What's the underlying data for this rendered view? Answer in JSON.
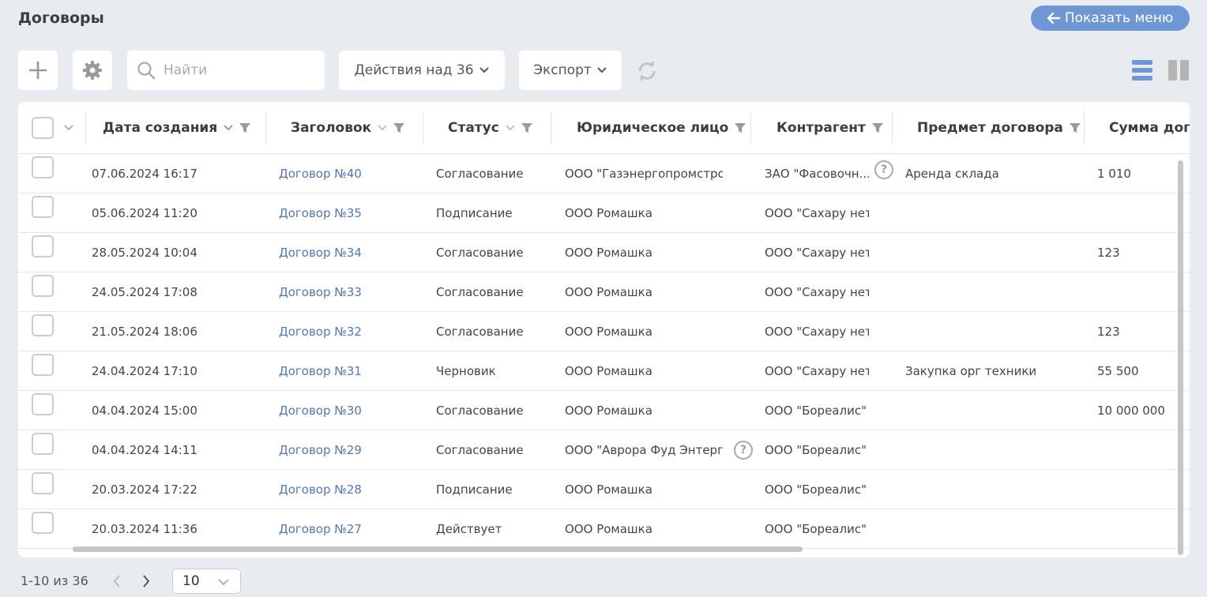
{
  "page": {
    "title": "Договоры",
    "show_menu": "Показать меню"
  },
  "toolbar": {
    "search_placeholder": "Найти",
    "actions_label": "Действия над 36",
    "export_label": "Экспорт"
  },
  "columns": [
    "Дата создания",
    "Заголовок",
    "Статус",
    "Юридическое лицо",
    "Контрагент",
    "Предмет договора",
    "Сумма дого"
  ],
  "rows": [
    {
      "date": "07.06.2024 16:17",
      "title": "Договор №40",
      "status": "Согласование",
      "entity": "ООО \"Газэнергопромстрой\"",
      "counterparty": "ЗАО \"Фасовочн...",
      "subject": "Аренда склада",
      "amount": "1 010"
    },
    {
      "date": "05.06.2024 11:20",
      "title": "Договор №35",
      "status": "Подписание",
      "entity": "ООО Ромашка",
      "counterparty": "ООО \"Сахару нет\"",
      "subject": "",
      "amount": ""
    },
    {
      "date": "28.05.2024 10:04",
      "title": "Договор №34",
      "status": "Согласование",
      "entity": "ООО Ромашка",
      "counterparty": "ООО \"Сахару нет\"",
      "subject": "",
      "amount": "123"
    },
    {
      "date": "24.05.2024 17:08",
      "title": "Договор №33",
      "status": "Согласование",
      "entity": "ООО Ромашка",
      "counterparty": "ООО \"Сахару нет\"",
      "subject": "",
      "amount": ""
    },
    {
      "date": "21.05.2024 18:06",
      "title": "Договор №32",
      "status": "Согласование",
      "entity": "ООО Ромашка",
      "counterparty": "ООО \"Сахару нет\"",
      "subject": "",
      "amount": "123"
    },
    {
      "date": "24.04.2024 17:10",
      "title": "Договор №31",
      "status": "Черновик",
      "entity": "ООО Ромашка",
      "counterparty": "ООО \"Сахару нет\"",
      "subject": "Закупка орг техники",
      "amount": "55 500"
    },
    {
      "date": "04.04.2024 15:00",
      "title": "Договор №30",
      "status": "Согласование",
      "entity": "ООО Ромашка",
      "counterparty": "ООО \"Бореалис\"",
      "subject": "",
      "amount": "10 000 000"
    },
    {
      "date": "04.04.2024 14:11",
      "title": "Договор №29",
      "status": "Согласование",
      "entity": "ООО \"Аврора Фуд Энтерп...",
      "counterparty": "ООО \"Бореалис\"",
      "subject": "",
      "amount": ""
    },
    {
      "date": "20.03.2024 17:22",
      "title": "Договор №28",
      "status": "Подписание",
      "entity": "ООО Ромашка",
      "counterparty": "ООО \"Бореалис\"",
      "subject": "",
      "amount": ""
    },
    {
      "date": "20.03.2024 11:36",
      "title": "Договор №27",
      "status": "Действует",
      "entity": "ООО Ромашка",
      "counterparty": "ООО \"Бореалис\"",
      "subject": "",
      "amount": ""
    }
  ],
  "footer": {
    "range": "1-10 из 36",
    "page_size": "10"
  },
  "colors": {
    "accent": "#6f97d3",
    "link": "#5577b0",
    "background": "#e8ecf0"
  }
}
